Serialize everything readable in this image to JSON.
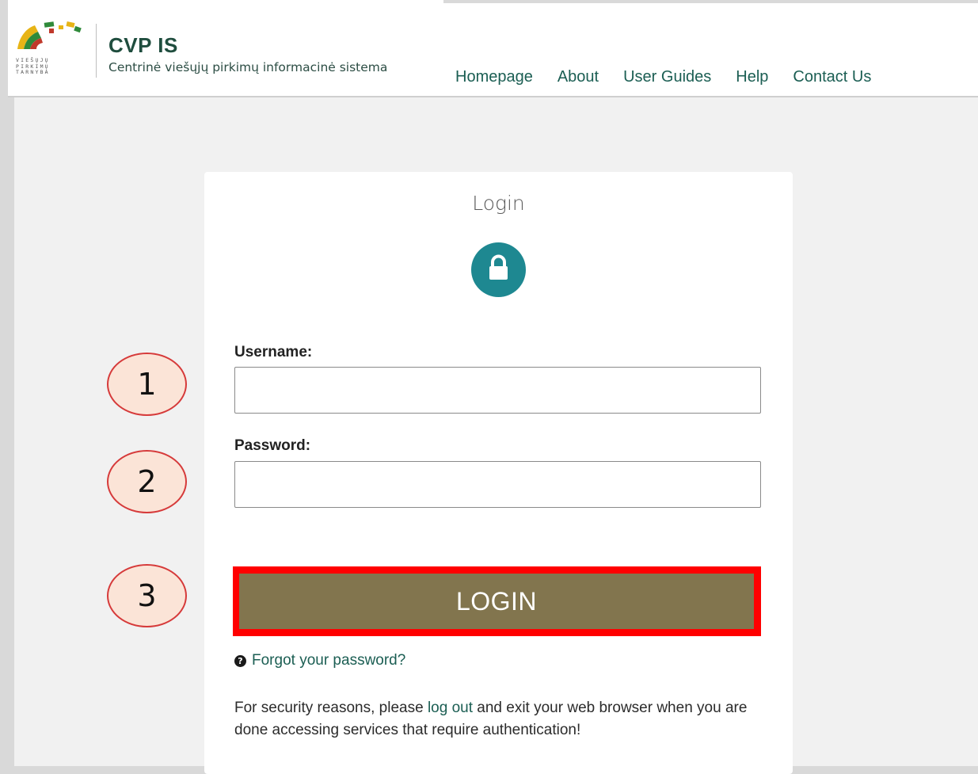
{
  "header": {
    "agency_lines": [
      "VIEŠŲJŲ",
      "PIRKIMŲ",
      "TARNYBA"
    ],
    "brand_title": "CVP IS",
    "brand_subtitle": "Centrinė viešųjų pirkimų informacinė sistema",
    "nav": [
      "Homepage",
      "About",
      "User Guides",
      "Help",
      "Contact Us"
    ]
  },
  "login": {
    "title": "Login",
    "icon": "lock-icon",
    "username_label": "Username:",
    "username_value": "",
    "password_label": "Password:",
    "password_value": "",
    "button_label": "LOGIN",
    "forgot_link": "Forgot your password?",
    "security_before": "For security reasons, please ",
    "security_link": "log out",
    "security_after": " and exit your web browser when you are done accessing services that require authentication!"
  },
  "annotations": [
    "1",
    "2",
    "3"
  ],
  "colors": {
    "brand_green": "#1f4d3e",
    "link_teal": "#1b5e53",
    "lock_circle": "#1e8891",
    "login_button": "#82754e",
    "highlight_red": "#ff0000",
    "callout_fill": "#fbe4d7",
    "callout_border": "#d63a3a"
  }
}
